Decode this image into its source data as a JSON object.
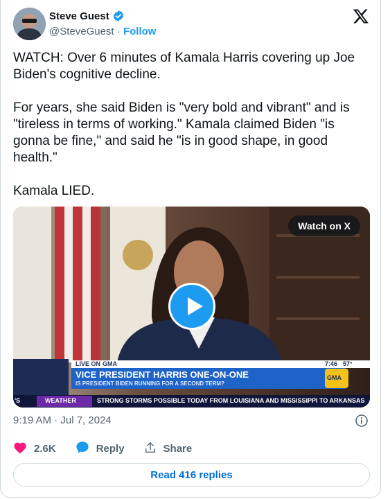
{
  "author": {
    "name": "Steve Guest",
    "handle": "@SteveGuest",
    "separator": "·",
    "follow_label": "Follow"
  },
  "tweet": {
    "text": "WATCH: Over 6 minutes of Kamala Harris covering up Joe Biden's cognitive decline.\n\nFor years, she said Biden is \"very bold and vibrant\" and is \"tireless in terms of working.\" Kamala claimed Biden \"is gonna be fine,\" and said he \"is in good shape, in good health.\"\n\nKamala LIED."
  },
  "media": {
    "watch_label": "Watch on X",
    "chyron": {
      "live_label": "LIVE ON",
      "network": "GMA",
      "headline": "VICE PRESIDENT HARRIS ONE-ON-ONE",
      "subhead": "IS PRESIDENT BIDEN RUNNING FOR A SECOND TERM?",
      "weather_label": "WEATHER",
      "ticker": "STRONG STORMS POSSIBLE TODAY FROM LOUISIANA AND MISSISSIPPI TO ARKANSAS",
      "clock": "7:46",
      "temp": "57°",
      "left_fragment": "'S"
    }
  },
  "timestamp": "9:19 AM · Jul 7, 2024",
  "actions": {
    "likes": "2.6K",
    "reply_label": "Reply",
    "share_label": "Share"
  },
  "read_replies_label": "Read 416 replies",
  "colors": {
    "accent": "#1d9bf0",
    "like": "#f91880",
    "link": "#006fd6",
    "muted": "#536471"
  }
}
